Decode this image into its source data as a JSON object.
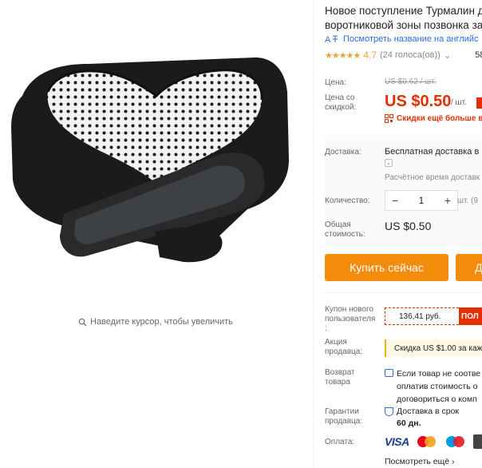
{
  "gallery": {
    "zoom_hint": "Наведите курсор, чтобы увеличить"
  },
  "product": {
    "title_line1": "Новое поступление Турмалин д",
    "title_line2": "воротниковой зоны позвонка за",
    "translate_link": "Посмотреть название на английс",
    "rating_stars": "★★★★★",
    "rating": "4.7",
    "votes": "(24 голоса(ов))",
    "orders": "58"
  },
  "price": {
    "price_label": "Цена:",
    "original_price": "US $0.62 / шт.",
    "discount_label_1": "Цена со",
    "discount_label_2": "скидкой:",
    "current_price": "US $0.50",
    "per_unit": "/ шт.",
    "more_discounts": "Скидки ещё больше в"
  },
  "shipping": {
    "label": "Доставка:",
    "value": "Бесплатная доставка в",
    "eta": "Расчётное время доставк"
  },
  "quantity": {
    "label": "Количество:",
    "minus": "−",
    "value": "1",
    "plus": "+",
    "unit": "шт. (9"
  },
  "total": {
    "label_1": "Общая",
    "label_2": "стоимость:",
    "value": "US $0.50"
  },
  "actions": {
    "buy_now": "Купить сейчас",
    "cart_initial": "Д"
  },
  "coupon": {
    "label_1": "Купон нового",
    "label_2": "пользователя",
    "label_3": ":",
    "amount": "136,41 руб.",
    "get": "ПОЛ"
  },
  "seller_promo": {
    "label_1": "Акция",
    "label_2": "продавца:",
    "text": "Скидка US $1.00 за каж"
  },
  "returns": {
    "label_1": "Возврат",
    "label_2": "товара",
    "line1": "Если товар не соотве",
    "line2": "оплатив стоимость о",
    "line3": "договориться о комп"
  },
  "guarantee": {
    "label_1": "Гарантии",
    "label_2": "продавца:",
    "line1": "Доставка в срок",
    "days": "60 дн."
  },
  "payment": {
    "label": "Оплата:",
    "visa": "VISA",
    "more": "Посмотреть ещё ›"
  },
  "colors": {
    "accent_red": "#e62e04",
    "buy_orange": "#f38b0b",
    "link_blue": "#2d6cdf",
    "star_gold": "#e6a43b"
  }
}
